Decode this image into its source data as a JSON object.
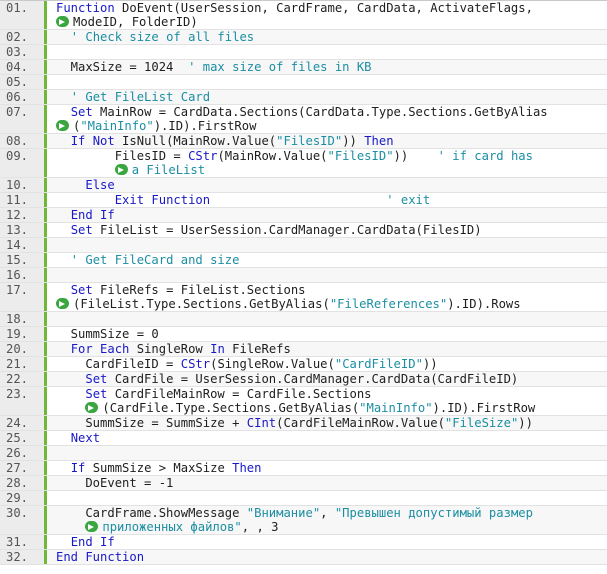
{
  "lines": [
    {
      "num": "01.",
      "segments": [
        {
          "t": "kw",
          "v": "Function"
        },
        {
          "t": "tx",
          "v": " DoEvent(UserSession, CardFrame, CardData, ActivateFlags,"
        }
      ],
      "cont": [
        [
          {
            "t": "tx",
            "v": "ModeID, FolderID)"
          }
        ]
      ]
    },
    {
      "num": "02.",
      "segments": [
        {
          "t": "tx",
          "v": "  "
        },
        {
          "t": "cm",
          "v": "' Check size of all files"
        }
      ]
    },
    {
      "num": "03.",
      "segments": []
    },
    {
      "num": "04.",
      "segments": [
        {
          "t": "tx",
          "v": "  MaxSize = 1024  "
        },
        {
          "t": "cm",
          "v": "' max size of files in KB"
        }
      ]
    },
    {
      "num": "05.",
      "segments": []
    },
    {
      "num": "06.",
      "segments": [
        {
          "t": "tx",
          "v": "  "
        },
        {
          "t": "cm",
          "v": "' Get FileList Card"
        }
      ]
    },
    {
      "num": "07.",
      "segments": [
        {
          "t": "tx",
          "v": "  "
        },
        {
          "t": "kw",
          "v": "Set"
        },
        {
          "t": "tx",
          "v": " MainRow = CardData.Sections(CardData.Type.Sections.GetByAlias"
        }
      ],
      "cont": [
        [
          {
            "t": "tx",
            "v": "("
          },
          {
            "t": "st",
            "v": "\"MainInfo\""
          },
          {
            "t": "tx",
            "v": ").ID).FirstRow"
          }
        ]
      ]
    },
    {
      "num": "08.",
      "segments": [
        {
          "t": "tx",
          "v": "  "
        },
        {
          "t": "kw",
          "v": "If Not"
        },
        {
          "t": "tx",
          "v": " IsNull(MainRow.Value("
        },
        {
          "t": "st",
          "v": "\"FilesID\""
        },
        {
          "t": "tx",
          "v": ")) "
        },
        {
          "t": "kw",
          "v": "Then"
        }
      ]
    },
    {
      "num": "09.",
      "segments": [
        {
          "t": "tx",
          "v": "        FilesID = "
        },
        {
          "t": "kw",
          "v": "CStr"
        },
        {
          "t": "tx",
          "v": "(MainRow.Value("
        },
        {
          "t": "st",
          "v": "\"FilesID\""
        },
        {
          "t": "tx",
          "v": "))    "
        },
        {
          "t": "cm",
          "v": "' if card has"
        }
      ],
      "cont": [
        [
          {
            "t": "cm",
            "v": "a FileList"
          }
        ]
      ],
      "cont_indent": "        "
    },
    {
      "num": "10.",
      "segments": [
        {
          "t": "tx",
          "v": "    "
        },
        {
          "t": "kw",
          "v": "Else"
        }
      ]
    },
    {
      "num": "11.",
      "segments": [
        {
          "t": "tx",
          "v": "        "
        },
        {
          "t": "kw",
          "v": "Exit Function"
        },
        {
          "t": "tx",
          "v": "                        "
        },
        {
          "t": "cm",
          "v": "' exit"
        }
      ]
    },
    {
      "num": "12.",
      "segments": [
        {
          "t": "tx",
          "v": "  "
        },
        {
          "t": "kw",
          "v": "End If"
        }
      ]
    },
    {
      "num": "13.",
      "segments": [
        {
          "t": "tx",
          "v": "  "
        },
        {
          "t": "kw",
          "v": "Set"
        },
        {
          "t": "tx",
          "v": " FileList = UserSession.CardManager.CardData(FilesID)"
        }
      ]
    },
    {
      "num": "14.",
      "segments": []
    },
    {
      "num": "15.",
      "segments": [
        {
          "t": "tx",
          "v": "  "
        },
        {
          "t": "cm",
          "v": "' Get FileCard and size"
        }
      ]
    },
    {
      "num": "16.",
      "segments": []
    },
    {
      "num": "17.",
      "segments": [
        {
          "t": "tx",
          "v": "  "
        },
        {
          "t": "kw",
          "v": "Set"
        },
        {
          "t": "tx",
          "v": " FileRefs = FileList.Sections"
        }
      ],
      "cont": [
        [
          {
            "t": "tx",
            "v": "(FileList.Type.Sections.GetByAlias("
          },
          {
            "t": "st",
            "v": "\"FileReferences\""
          },
          {
            "t": "tx",
            "v": ").ID).Rows"
          }
        ]
      ]
    },
    {
      "num": "18.",
      "segments": []
    },
    {
      "num": "19.",
      "segments": [
        {
          "t": "tx",
          "v": "  SummSize = 0"
        }
      ]
    },
    {
      "num": "20.",
      "segments": [
        {
          "t": "tx",
          "v": "  "
        },
        {
          "t": "kw",
          "v": "For Each"
        },
        {
          "t": "tx",
          "v": " SingleRow "
        },
        {
          "t": "kw",
          "v": "In"
        },
        {
          "t": "tx",
          "v": " FileRefs"
        }
      ]
    },
    {
      "num": "21.",
      "segments": [
        {
          "t": "tx",
          "v": "    CardFileID = "
        },
        {
          "t": "kw",
          "v": "CStr"
        },
        {
          "t": "tx",
          "v": "(SingleRow.Value("
        },
        {
          "t": "st",
          "v": "\"CardFileID\""
        },
        {
          "t": "tx",
          "v": "))"
        }
      ]
    },
    {
      "num": "22.",
      "segments": [
        {
          "t": "tx",
          "v": "    "
        },
        {
          "t": "kw",
          "v": "Set"
        },
        {
          "t": "tx",
          "v": " CardFile = UserSession.CardManager.CardData(CardFileID)"
        }
      ]
    },
    {
      "num": "23.",
      "segments": [
        {
          "t": "tx",
          "v": "    "
        },
        {
          "t": "kw",
          "v": "Set"
        },
        {
          "t": "tx",
          "v": " CardFileMainRow = CardFile.Sections"
        }
      ],
      "cont": [
        [
          {
            "t": "tx",
            "v": "(CardFile.Type.Sections.GetByAlias("
          },
          {
            "t": "st",
            "v": "\"MainInfo\""
          },
          {
            "t": "tx",
            "v": ").ID).FirstRow"
          }
        ]
      ],
      "cont_indent": "    "
    },
    {
      "num": "24.",
      "segments": [
        {
          "t": "tx",
          "v": "    SummSize = SummSize + "
        },
        {
          "t": "kw",
          "v": "CInt"
        },
        {
          "t": "tx",
          "v": "(CardFileMainRow.Value("
        },
        {
          "t": "st",
          "v": "\"FileSize\""
        },
        {
          "t": "tx",
          "v": "))"
        }
      ]
    },
    {
      "num": "25.",
      "segments": [
        {
          "t": "tx",
          "v": "  "
        },
        {
          "t": "kw",
          "v": "Next"
        }
      ]
    },
    {
      "num": "26.",
      "segments": []
    },
    {
      "num": "27.",
      "segments": [
        {
          "t": "tx",
          "v": "  "
        },
        {
          "t": "kw",
          "v": "If"
        },
        {
          "t": "tx",
          "v": " SummSize > MaxSize "
        },
        {
          "t": "kw",
          "v": "Then"
        }
      ]
    },
    {
      "num": "28.",
      "segments": [
        {
          "t": "tx",
          "v": "    DoEvent = -1"
        }
      ]
    },
    {
      "num": "29.",
      "segments": []
    },
    {
      "num": "30.",
      "segments": [
        {
          "t": "tx",
          "v": "    CardFrame.ShowMessage "
        },
        {
          "t": "st",
          "v": "\"Внимание\""
        },
        {
          "t": "tx",
          "v": ", "
        },
        {
          "t": "st",
          "v": "\"Превышен допустимый размер"
        }
      ],
      "cont": [
        [
          {
            "t": "st",
            "v": "приложенных файлов\""
          },
          {
            "t": "tx",
            "v": ", , 3"
          }
        ]
      ],
      "cont_indent": "    "
    },
    {
      "num": "31.",
      "segments": [
        {
          "t": "tx",
          "v": "  "
        },
        {
          "t": "kw",
          "v": "End If"
        }
      ]
    },
    {
      "num": "32.",
      "segments": [
        {
          "t": "kw",
          "v": "End Function"
        }
      ]
    }
  ]
}
